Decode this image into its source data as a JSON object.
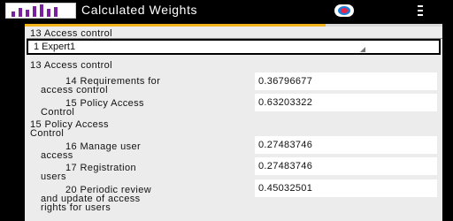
{
  "app": {
    "title": "Calculated Weights",
    "logo_bars": [
      6,
      10,
      8,
      12,
      14,
      9,
      11
    ]
  },
  "progress": {
    "fraction": 0.72,
    "color": "#f3b41b"
  },
  "selector": {
    "section_title": "13 Access control",
    "expert_value": "1 Expert1"
  },
  "groups": [
    {
      "title": "13 Access control",
      "criteria": [
        {
          "label_line1": "14 Requirements for",
          "label_line2": "access control",
          "value": "0.36796677"
        },
        {
          "label_line1": "15 Policy Access",
          "label_line2": "Control",
          "value": "0.63203322"
        }
      ]
    },
    {
      "title_line1": "15 Policy Access",
      "title_line2": "Control",
      "criteria": [
        {
          "label_line1": "16 Manage user",
          "label_line2": "access",
          "value": "0.27483746"
        },
        {
          "label_line1": "17 Registration",
          "label_line2": "users",
          "value": "0.27483746"
        },
        {
          "label_line1": "20 Periodic review",
          "label_line2": "and update of access",
          "label_line3": "rights for users",
          "value": "0.45032501"
        }
      ]
    }
  ]
}
